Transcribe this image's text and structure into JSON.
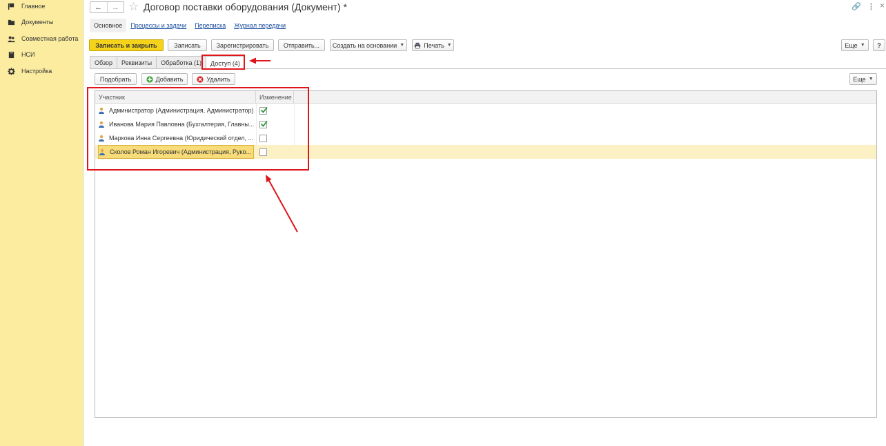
{
  "sidebar": {
    "items": [
      {
        "label": "Главное",
        "icon": "flag-icon"
      },
      {
        "label": "Документы",
        "icon": "folder-icon"
      },
      {
        "label": "Совместная работа",
        "icon": "users-icon"
      },
      {
        "label": "НСИ",
        "icon": "book-icon"
      },
      {
        "label": "Настройка",
        "icon": "gear-icon"
      }
    ]
  },
  "header": {
    "back": "←",
    "forward": "→",
    "title": "Договор поставки оборудования (Документ) *",
    "star": "☆",
    "link": "🔗",
    "more": "⋮",
    "close": "×"
  },
  "sections": [
    "Основное",
    "Процессы и задачи",
    "Переписка",
    "Журнал передачи"
  ],
  "toolbar": {
    "save_close": "Записать и закрыть",
    "save": "Записать",
    "register": "Зарегистрировать",
    "send": "Отправить...",
    "create_based": "Создать на основании",
    "print": "Печать",
    "more": "Еще",
    "help": "?"
  },
  "tabs": [
    "Обзор",
    "Реквизиты",
    "Обработка (1)",
    "Доступ (4)"
  ],
  "subtoolbar": {
    "pick": "Подобрать",
    "add": "Добавить",
    "delete": "Удалить",
    "more": "Еще"
  },
  "table": {
    "columns": [
      "Участник",
      "Изменение"
    ],
    "rows": [
      {
        "name": "Администратор (Администрация, Администратор)",
        "edit": true
      },
      {
        "name": "Иванова Мария Павловна (Бухгалтерия, Главны...",
        "edit": true
      },
      {
        "name": "Маркова Инна Сергеевна (Юридический отдел, ...",
        "edit": false
      },
      {
        "name": "Сколов Роман Игоревич (Администрация, Руко...",
        "edit": false
      }
    ]
  },
  "colors": {
    "sidebar_bg": "#fbeca0",
    "primary_button": "#f5d31b",
    "annotation_red": "#e0141b",
    "link": "#1a4ea1"
  }
}
